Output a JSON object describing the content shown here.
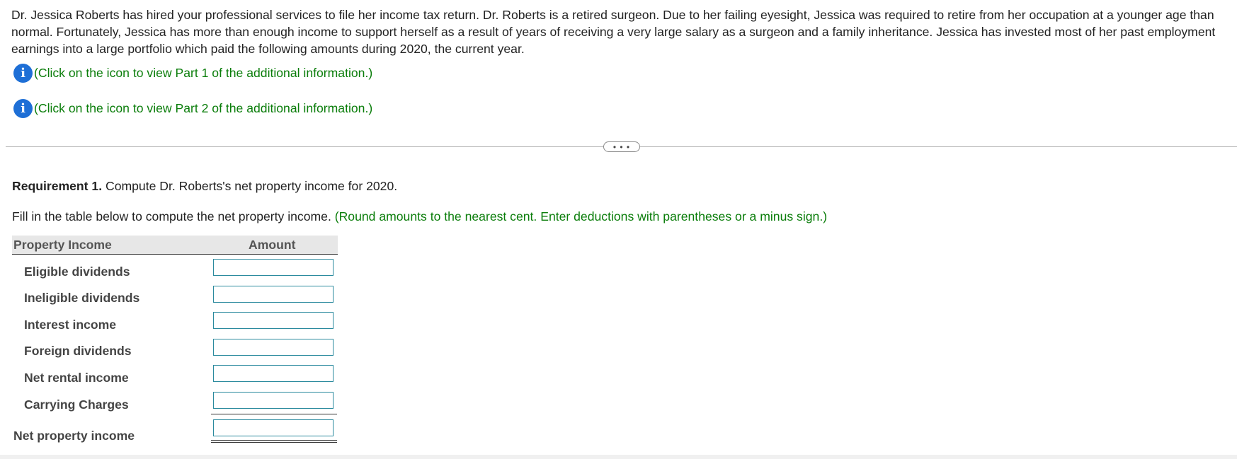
{
  "intro": {
    "text": "Dr. Jessica Roberts has hired your professional services to file her income tax return. Dr. Roberts is a retired surgeon. Due to her failing eyesight, Jessica was required to retire from her occupation at a younger age than normal. Fortunately, Jessica has more than enough income to support herself as a result of years of receiving a very large salary as a surgeon and a family inheritance. Jessica has invested most of her past employment earnings into a large portfolio which paid the following amounts during 2020, the current year."
  },
  "info_links": [
    {
      "icon": "info-icon",
      "label": "(Click on the icon to view Part 1 of the additional information.)"
    },
    {
      "icon": "info-icon",
      "label": "(Click on the icon to view Part 2 of the additional information.)"
    }
  ],
  "expander": {
    "label": "• • •"
  },
  "requirement": {
    "prefix": "Requirement 1.",
    "text": " Compute Dr. Roberts's net property income for 2020."
  },
  "instructions": {
    "text": "Fill in the table below to compute the net property income. ",
    "note": "(Round amounts to the nearest cent. Enter deductions with parentheses or a minus sign.)"
  },
  "table": {
    "col1": "Property Income",
    "col2": "Amount",
    "rows": [
      {
        "label": "Eligible dividends",
        "value": ""
      },
      {
        "label": "Ineligible dividends",
        "value": ""
      },
      {
        "label": "Interest income",
        "value": ""
      },
      {
        "label": "Foreign dividends",
        "value": ""
      },
      {
        "label": "Net rental income",
        "value": ""
      },
      {
        "label": "Carrying Charges",
        "value": ""
      }
    ],
    "total": {
      "label": "Net property income",
      "value": ""
    }
  },
  "colors": {
    "accent_green": "#0a7d0a",
    "info_blue": "#1e6fd6",
    "input_border": "#2b8a9e"
  }
}
